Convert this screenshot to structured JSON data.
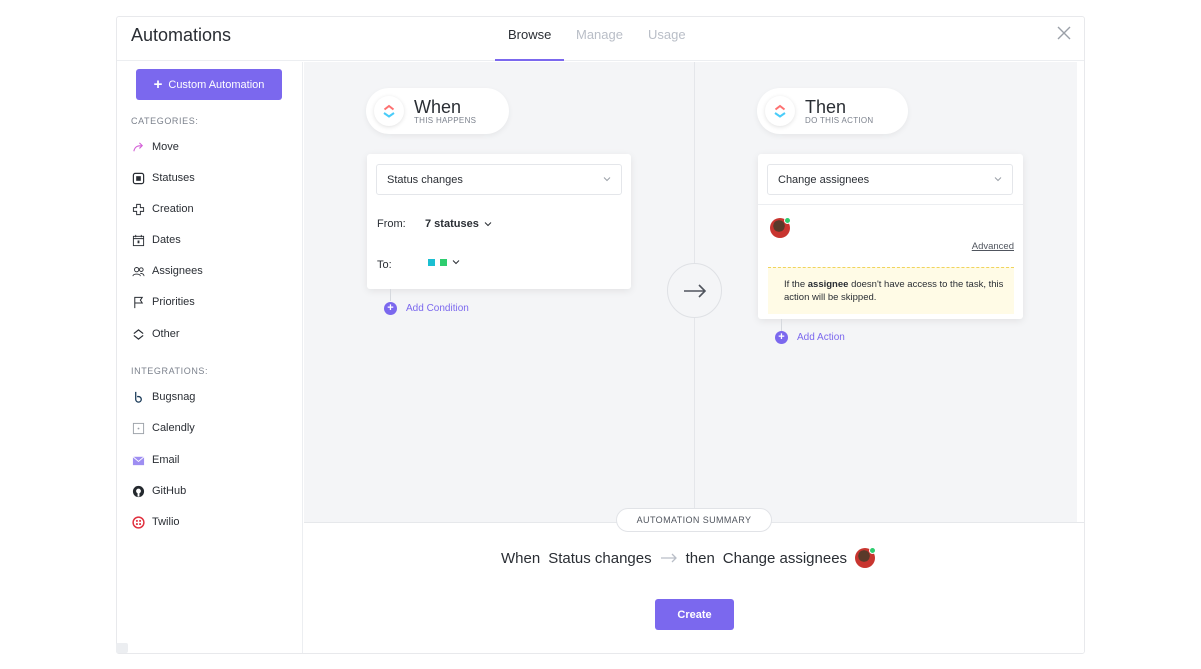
{
  "window": {
    "title": "Automations"
  },
  "tabs": [
    {
      "label": "Browse",
      "active": true
    },
    {
      "label": "Manage",
      "active": false
    },
    {
      "label": "Usage",
      "active": false
    }
  ],
  "sidebar": {
    "custom_button": "Custom Automation",
    "categories_label": "CATEGORIES:",
    "categories": [
      {
        "label": "Move",
        "icon": "move-icon"
      },
      {
        "label": "Statuses",
        "icon": "statuses-icon"
      },
      {
        "label": "Creation",
        "icon": "creation-icon"
      },
      {
        "label": "Dates",
        "icon": "calendar-icon"
      },
      {
        "label": "Assignees",
        "icon": "assignees-icon"
      },
      {
        "label": "Priorities",
        "icon": "flag-icon"
      },
      {
        "label": "Other",
        "icon": "other-icon"
      }
    ],
    "integrations_label": "INTEGRATIONS:",
    "integrations": [
      {
        "label": "Bugsnag",
        "icon": "bugsnag-icon"
      },
      {
        "label": "Calendly",
        "icon": "calendly-icon"
      },
      {
        "label": "Email",
        "icon": "email-icon"
      },
      {
        "label": "GitHub",
        "icon": "github-icon"
      },
      {
        "label": "Twilio",
        "icon": "twilio-icon"
      }
    ]
  },
  "trigger": {
    "title": "When",
    "subtitle": "THIS HAPPENS",
    "select_value": "Status changes",
    "from_label": "From:",
    "from_value": "7 statuses",
    "to_label": "To:",
    "add_label": "Add Condition"
  },
  "action": {
    "title": "Then",
    "subtitle": "DO THIS ACTION",
    "select_value": "Change assignees",
    "advanced_label": "Advanced",
    "warning_pre": "If the ",
    "warning_bold": "assignee",
    "warning_post": " doesn't have access to the task, this action will be skipped.",
    "add_label": "Add Action"
  },
  "summary": {
    "badge": "AUTOMATION SUMMARY",
    "when_word": "When",
    "trigger": "Status changes",
    "then_word": "then",
    "action": "Change assignees"
  },
  "create_label": "Create",
  "colors": {
    "accent": "#7b68ee",
    "status_teal": "#1bbfd1",
    "status_green": "#2ecd6f"
  }
}
